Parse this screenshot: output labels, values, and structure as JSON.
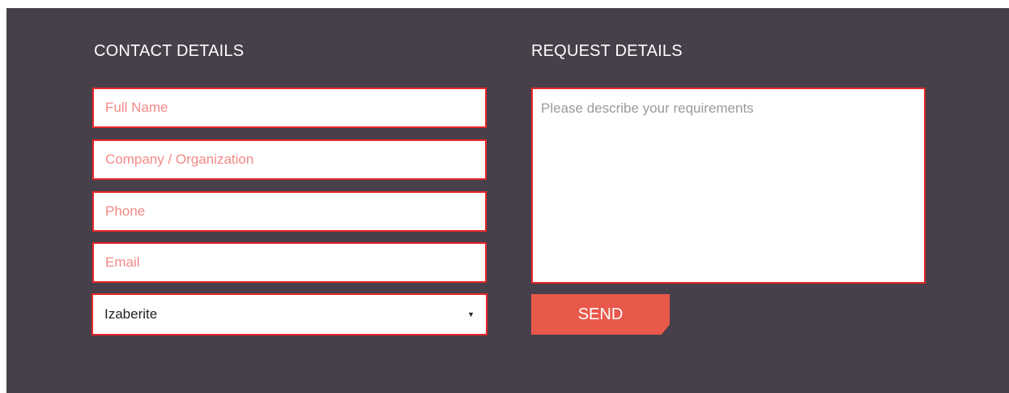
{
  "contact": {
    "heading": "CONTACT DETAILS",
    "full_name_placeholder": "Full Name",
    "company_placeholder": "Company / Organization",
    "phone_placeholder": "Phone",
    "email_placeholder": "Email",
    "select_value": "Izaberite"
  },
  "request": {
    "heading": "REQUEST DETAILS",
    "requirements_placeholder": "Please describe your requirements",
    "send_label": "SEND"
  },
  "colors": {
    "background": "#473f4a",
    "field_border": "#e8282a",
    "send_button": "#e8584b"
  }
}
